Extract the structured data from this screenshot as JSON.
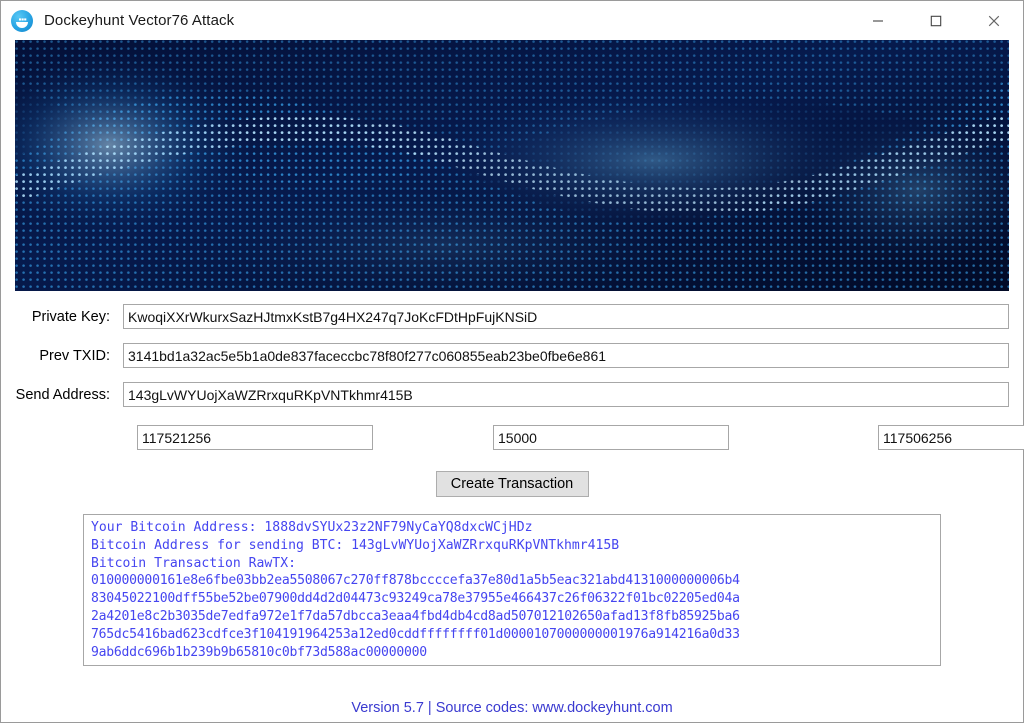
{
  "window": {
    "title": "Dockeyhunt Vector76 Attack",
    "icon": "docker-whale-icon",
    "controls": {
      "minimize": "minimize-icon",
      "maximize": "maximize-icon",
      "close": "close-icon"
    }
  },
  "banner": {
    "alt": "blue abstract particle wave banner",
    "base_color": "#041038",
    "dot_color": "#2f9fe8",
    "highlight_color": "#9fe4ff"
  },
  "form": {
    "fields": [
      {
        "label": "Private Key:",
        "value": "KwoqiXXrWkurxSazHJtmxKstB7g4HX247q7JoKcFDtHpFujKNSiD",
        "placeholder": ""
      },
      {
        "label": "Prev TXID:",
        "value": "3141bd1a32ac5e5b1a0de837faceccbc78f80f277c060855eab23be0fbe6e861",
        "placeholder": ""
      },
      {
        "label": "Send Address:",
        "value": "143gLvWYUojXaWZRrxquRKpVNTkhmr415B",
        "placeholder": ""
      }
    ],
    "amounts": {
      "input_amount": "117521256",
      "fee_amount": "15000",
      "output_amount": "117506256"
    },
    "create_button_label": "Create Transaction"
  },
  "output": {
    "lines": [
      "Your Bitcoin Address: 1888dvSYUx23z2NF79NyCaYQ8dxcWCjHDz",
      "Bitcoin Address for sending BTC: 143gLvWYUojXaWZRrxquRKpVNTkhmr415B",
      "Bitcoin Transaction RawTX:",
      "010000000161e8e6fbe03bb2ea5508067c270ff878bccccefa37e80d1a5b5eac321abd4131000000006b4",
      "83045022100dff55be52be07900dd4d2d04473c93249ca78e37955e466437c26f06322f01bc02205ed04a",
      "2a4201e8c2b3035de7edfa972e1f7da57dbcca3eaa4fbd4db4cd8ad507012102650afad13f8fb85925ba6",
      "765dc5416bad623cdfce3f104191964253a12ed0cddffffffff01d0000107000000001976a914216a0d33",
      "9ab6ddc696b1b239b9b65810c0bf73d588ac00000000"
    ],
    "text_color": "#4545f0"
  },
  "footer": {
    "text": "Version 5.7 | Source codes: www.dockeyhunt.com",
    "color": "#3a3ad0"
  }
}
